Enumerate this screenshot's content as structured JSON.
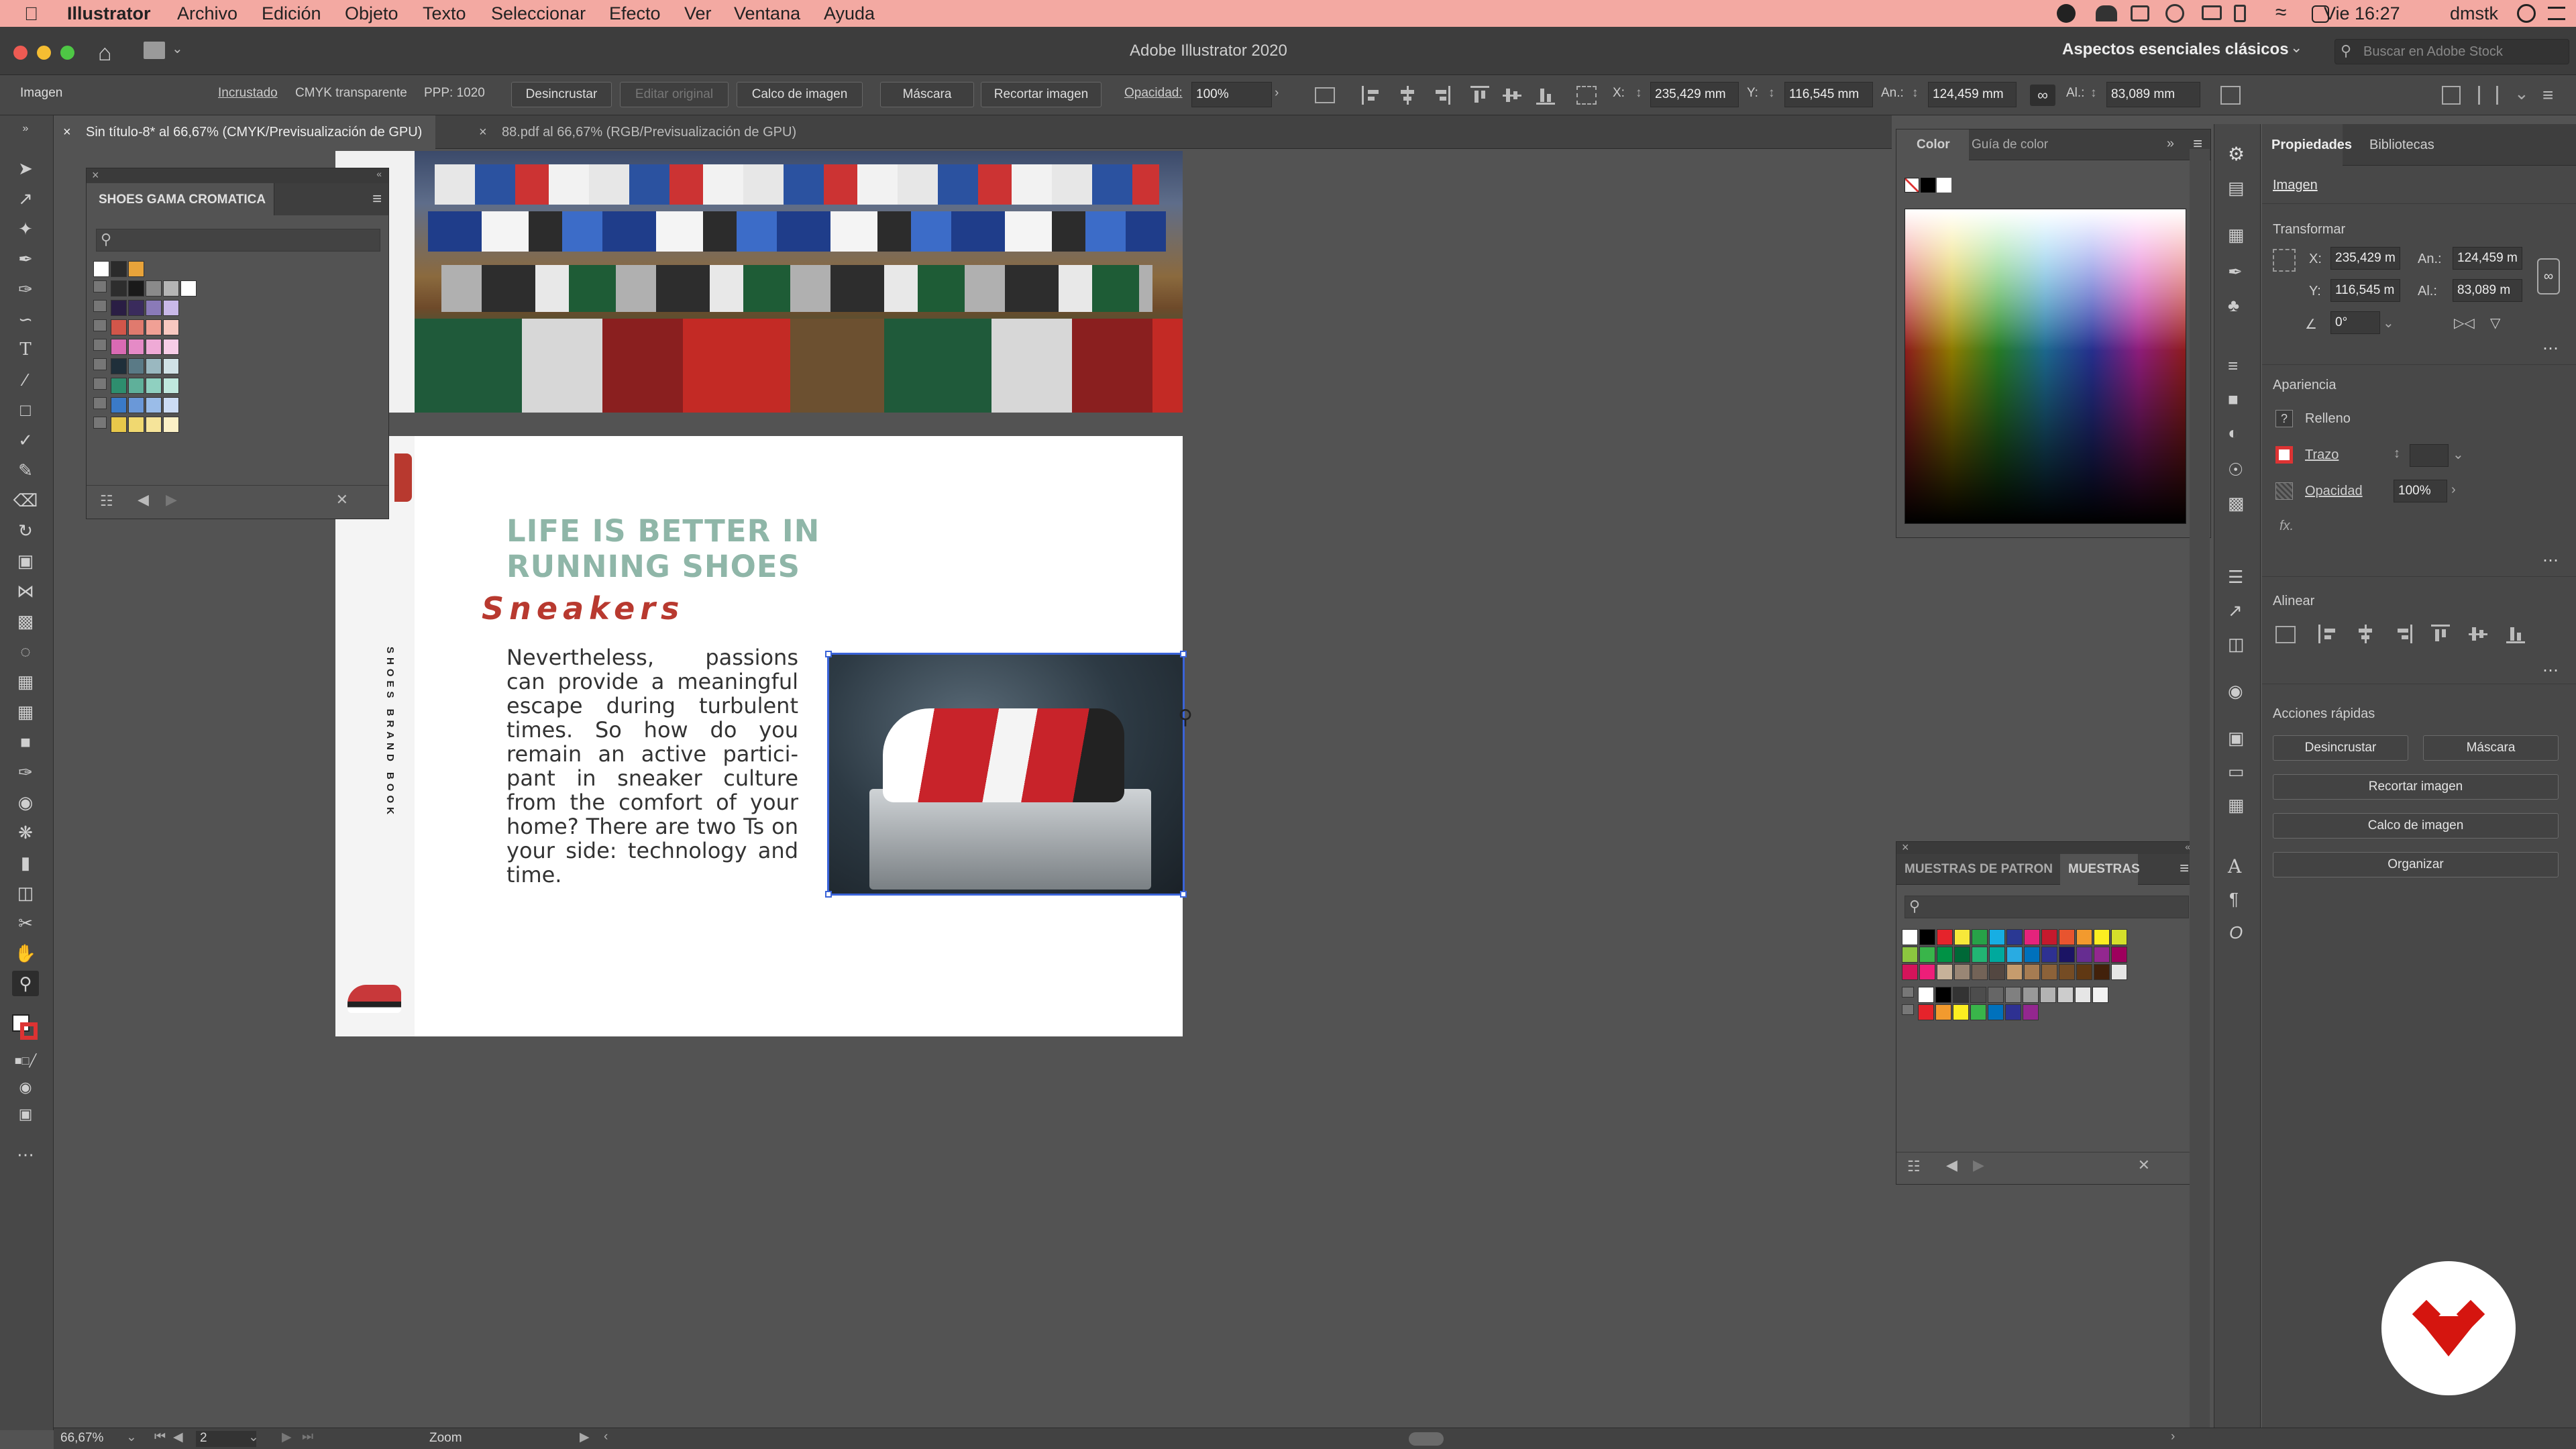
{
  "menubar": {
    "apple_icon": "apple-icon",
    "app": "Illustrator",
    "items": [
      "Archivo",
      "Edición",
      "Objeto",
      "Texto",
      "Seleccionar",
      "Efecto",
      "Ver",
      "Ventana",
      "Ayuda"
    ],
    "clock": "Vie 16:27",
    "user": "dmstk"
  },
  "titlebar": {
    "title": "Adobe Illustrator 2020",
    "workspace": "Aspectos esenciales clásicos",
    "search_placeholder": "Buscar en Adobe Stock"
  },
  "controlbar": {
    "object_type": "Imagen",
    "embedded": "Incrustado",
    "color_mode": "CMYK transparente",
    "ppp": "PPP: 1020",
    "unembed": "Desincrustar",
    "edit_original": "Editar original",
    "image_trace": "Calco de imagen",
    "mask": "Máscara",
    "crop": "Recortar imagen",
    "opacity_label": "Opacidad:",
    "opacity": "100%",
    "x_label": "X:",
    "x": "235,429 mm",
    "y_label": "Y:",
    "y": "116,545 mm",
    "w_label": "An.:",
    "w": "124,459 mm",
    "h_label": "Al.:",
    "h": "83,089 mm"
  },
  "tabs": [
    {
      "label": "Sin título-8* al 66,67% (CMYK/Previsualización de GPU)"
    },
    {
      "label": "88.pdf al 66,67% (RGB/Previsualización de GPU)"
    }
  ],
  "artboard": {
    "headline1": "LIFE IS BETTER IN",
    "headline2": "RUNNING SHOES",
    "subhead": "Sneakers",
    "body": "Nevertheless, passions can provide a meaningful escape during turbulent times. So how do you remain an active partici-pant in sneaker culture from the comfort of your home? There are two Ts on your side: technology and time.",
    "side_text": "SHOES BRAND BOOK"
  },
  "swatch_panel_left": {
    "title": "SHOES GAMA CROMATICA",
    "rows": [
      [
        "#ffffff",
        "#2b2b2b",
        "#e8a33a"
      ],
      [
        "#2d2d2d",
        "#1a1a1a",
        "#8a8a8a",
        "#b5b5b5",
        "#ffffff"
      ],
      [
        "#2a1e44",
        "#3a2b5c",
        "#8a7ab8",
        "#c9b8e8"
      ],
      [
        "#d2564a",
        "#e07a6e",
        "#f0a095",
        "#f8c8c0"
      ],
      [
        "#d96ab4",
        "#e58ac6",
        "#efaad6",
        "#f7cde7"
      ],
      [
        "#1f2f3a",
        "#5a7a86",
        "#9ab8c0",
        "#d0e2e6"
      ],
      [
        "#2e8e6e",
        "#5fb09a",
        "#8fd0c0",
        "#c0e8de"
      ],
      [
        "#3a7ac8",
        "#6a98d8",
        "#9abce8",
        "#ccdcf4"
      ],
      [
        "#e8c84a",
        "#f0d870",
        "#f6e49a",
        "#fbf0c6"
      ]
    ]
  },
  "color_panel": {
    "tabs": [
      "Color",
      "Guía de color"
    ]
  },
  "swatches_panel": {
    "tabs": [
      "MUESTRAS DE PATRON",
      "MUESTRAS"
    ],
    "row1": [
      "#ffffff",
      "#000000",
      "#e5232b",
      "#f7e83a",
      "#27a248",
      "#17aee3",
      "#2a3893",
      "#e4237c",
      "#c5192d",
      "#e8542f",
      "#f29a2e",
      "#fcee21",
      "#d5e02b"
    ],
    "row2": [
      "#8cc63f",
      "#39b54a",
      "#009245",
      "#006837",
      "#22b573",
      "#00a99d",
      "#29abe2",
      "#0071bc",
      "#2e3192",
      "#1b1464",
      "#662d91",
      "#93278f",
      "#9e005d"
    ],
    "row3": [
      "#d4145a",
      "#ed1e79",
      "#c7b299",
      "#998675",
      "#736357",
      "#534741",
      "#c69c6d",
      "#a67c52",
      "#8c6239",
      "#754c24",
      "#603813",
      "#42210b",
      "#e6e6e6"
    ],
    "row4": [
      "#ffffff",
      "#000000",
      "#333333",
      "#4d4d4d",
      "#666666",
      "#808080",
      "#999999",
      "#b3b3b3",
      "#cccccc",
      "#e6e6e6",
      "#f2f2f2"
    ],
    "row5": [
      "#e5232b",
      "#f29a2e",
      "#fcee21",
      "#39b54a",
      "#0071bc",
      "#2e3192",
      "#93278f"
    ]
  },
  "properties": {
    "tabs": [
      "Propiedades",
      "Bibliotecas"
    ],
    "object": "Imagen",
    "transform_title": "Transformar",
    "x_label": "X:",
    "x": "235,429 m",
    "y_label": "Y:",
    "y": "116,545 m",
    "w_label": "An.:",
    "w": "124,459 m",
    "h_label": "Al.:",
    "h": "83,089 m",
    "angle": "0°",
    "appearance_title": "Apariencia",
    "fill_label": "Relleno",
    "stroke_label": "Trazo",
    "opacity_label": "Opacidad",
    "opacity": "100%",
    "fx": "fx.",
    "align_title": "Alinear",
    "quick_title": "Acciones rápidas",
    "btn_unembed": "Desincrustar",
    "btn_mask": "Máscara",
    "btn_crop": "Recortar imagen",
    "btn_trace": "Calco de imagen",
    "btn_arrange": "Organizar"
  },
  "statusbar": {
    "zoom": "66,67%",
    "artboard_num": "2",
    "tool": "Zoom"
  },
  "colors": {
    "menubar_bg": "#f3a9a2",
    "headline_green": "#8fb6a8",
    "subhead_red": "#b8392f",
    "logo_red": "#d5150f"
  }
}
